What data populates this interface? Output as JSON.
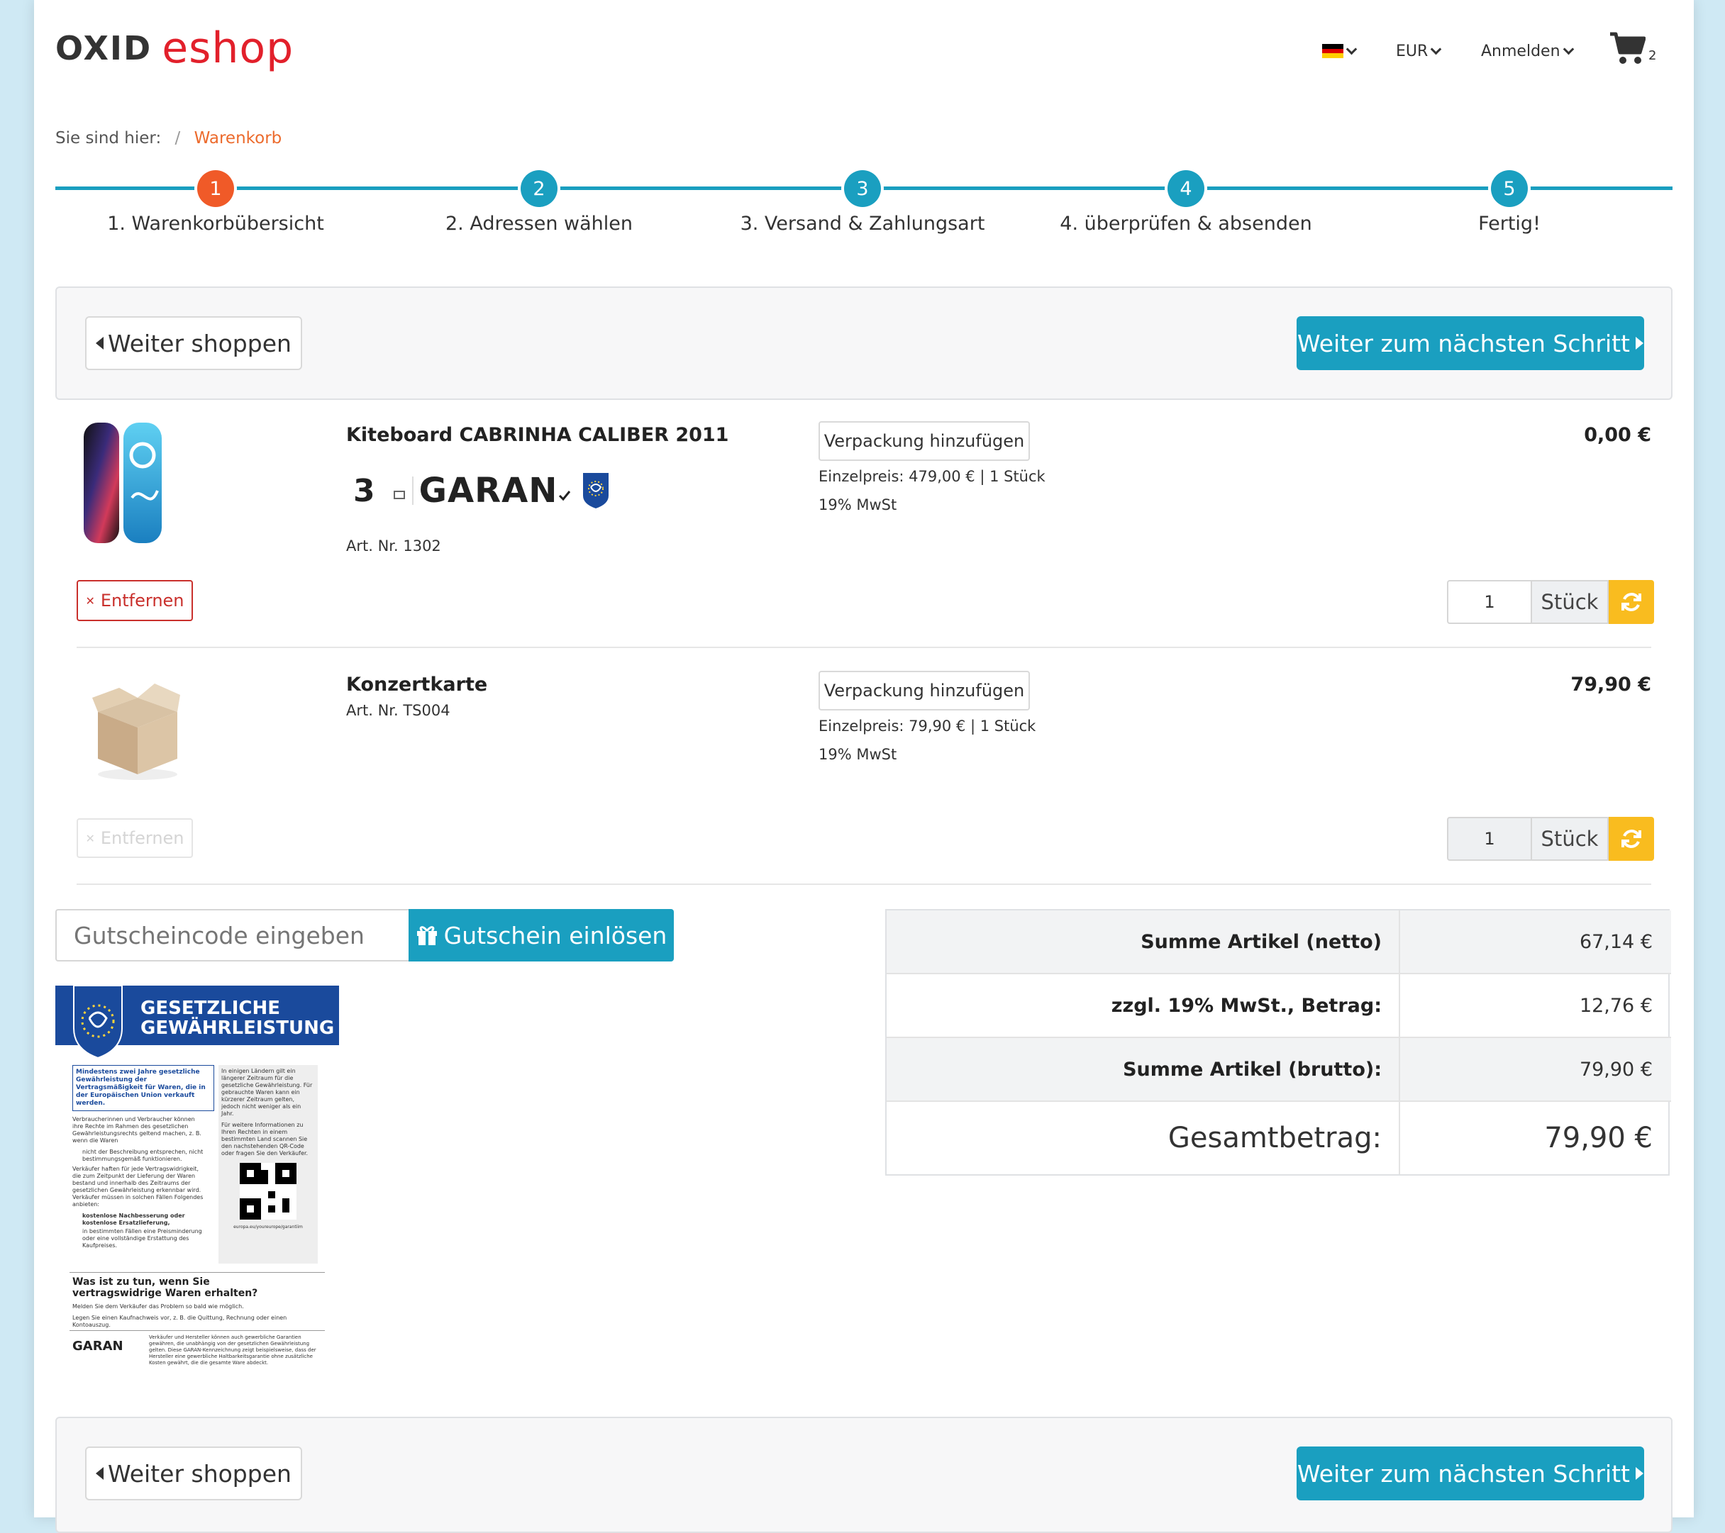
{
  "header": {
    "logo_oxid": "OXID",
    "logo_eshop": "eshop",
    "language_icon": "german-flag-icon",
    "currency": "EUR",
    "login": "Anmelden",
    "cart_count": "2"
  },
  "breadcrumb": {
    "prefix": "Sie sind hier:",
    "separator": "/",
    "current": "Warenkorb"
  },
  "steps": [
    {
      "num": "1",
      "label": "1. Warenkorbübersicht",
      "active": true
    },
    {
      "num": "2",
      "label": "2. Adressen wählen",
      "active": false
    },
    {
      "num": "3",
      "label": "3. Versand & Zahlungsart",
      "active": false
    },
    {
      "num": "4",
      "label": "4. überprüfen & absenden",
      "active": false
    },
    {
      "num": "5",
      "label": "Fertig!",
      "active": false
    }
  ],
  "actions": {
    "continue_shopping": "Weiter shoppen",
    "next_step": "Weiter zum nächsten Schritt"
  },
  "items": [
    {
      "title": "Kiteboard CABRINHA CALIBER 2011",
      "garan_years": "3",
      "garan_text": "GARAN",
      "artnr": "Art. Nr. 1302",
      "wrap": "Verpackung hinzufügen",
      "unit_price": "Einzelpreis: 479,00 € | 1 Stück",
      "vat": "19% MwSt",
      "price": "0,00 €",
      "remove": "Entfernen",
      "qty": "1",
      "unit": "Stück"
    },
    {
      "title": "Konzertkarte",
      "artnr": "Art. Nr. TS004",
      "wrap": "Verpackung hinzufügen",
      "unit_price": "Einzelpreis: 79,90 € | 1 Stück",
      "vat": "19% MwSt",
      "price": "79,90 €",
      "remove": "Entfernen",
      "qty": "1",
      "unit": "Stück"
    }
  ],
  "voucher": {
    "placeholder": "Gutscheincode eingeben",
    "button": "Gutschein einlösen"
  },
  "legal": {
    "title_line1": "GESETZLICHE",
    "title_line2": "GEWÄHRLEISTUNG",
    "intro": "Mindestens zwei Jahre gesetzliche Gewährleistung der Vertragsmäßigkeit für Waren, die in der Europäischen Union verkauft werden.",
    "right_text": "In einigen Ländern gilt ein längerer Zeitraum für die gesetzliche Gewährleistung. Für gebrauchte Waren kann ein kürzerer Zeitraum gelten, jedoch nicht weniger als ein Jahr.",
    "right_text2": "Für weitere Informationen zu Ihren Rechten in einem bestimmten Land scannen Sie den nachstehenden QR-Code oder fragen Sie den Verkäufer.",
    "url": "europa.eu/youreurope/garantiim",
    "body1": "Verbraucherinnen und Verbraucher können ihre Rechte im Rahmen des gesetzlichen Gewährleistungsrechts geltend machen, z. B. wenn die Waren",
    "bullet1": "nicht der Beschreibung entsprechen, nicht bestimmungsgemäß funktionieren.",
    "body2": "Verkäufer haften für jede Vertragswidrigkeit, die zum Zeitpunkt der Lieferung der Waren bestand und innerhalb des Zeitraums der gesetzlichen Gewährleistung erkennbar wird. Verkäufer müssen in solchen Fällen Folgendes anbieten:",
    "bullet2": "kostenlose Nachbesserung oder kostenlose Ersatzlieferung,",
    "bullet3": "in bestimmten Fällen eine Preisminderung oder eine vollständige Erstattung des Kaufpreises.",
    "what_title": "Was ist zu tun, wenn Sie vertragswidrige Waren erhalten?",
    "step1": "Melden Sie dem Verkäufer das Problem so bald wie möglich.",
    "step2": "Legen Sie einen Kaufnachweis vor, z. B. die Quittung, Rechnung oder einen Kontoauszug.",
    "garan": "GARAN",
    "footer": "Verkäufer und Hersteller können auch gewerbliche Garantien gewähren, die unabhängig von der gesetzlichen Gewährleistung gelten. Diese GARAN-Kennzeichnung zeigt beispielsweise, dass der Hersteller eine gewerbliche Haltbarkeitsgarantie ohne zusätzliche Kosten gewährt, die die gesamte Ware abdeckt."
  },
  "totals": [
    {
      "label": "Summe Artikel (netto)",
      "value": "67,14 €"
    },
    {
      "label": "zzgl. 19% MwSt., Betrag:",
      "value": "12,76 €"
    },
    {
      "label": "Summe Artikel (brutto):",
      "value": "79,90 €"
    },
    {
      "label": "Gesamtbetrag:",
      "value": "79,90 €"
    }
  ],
  "colors": {
    "primary": "#1a9fc0",
    "accent": "#f05a28",
    "warning": "#f9bc1f",
    "danger": "#c9302c",
    "legal_blue": "#1a4a9c"
  }
}
